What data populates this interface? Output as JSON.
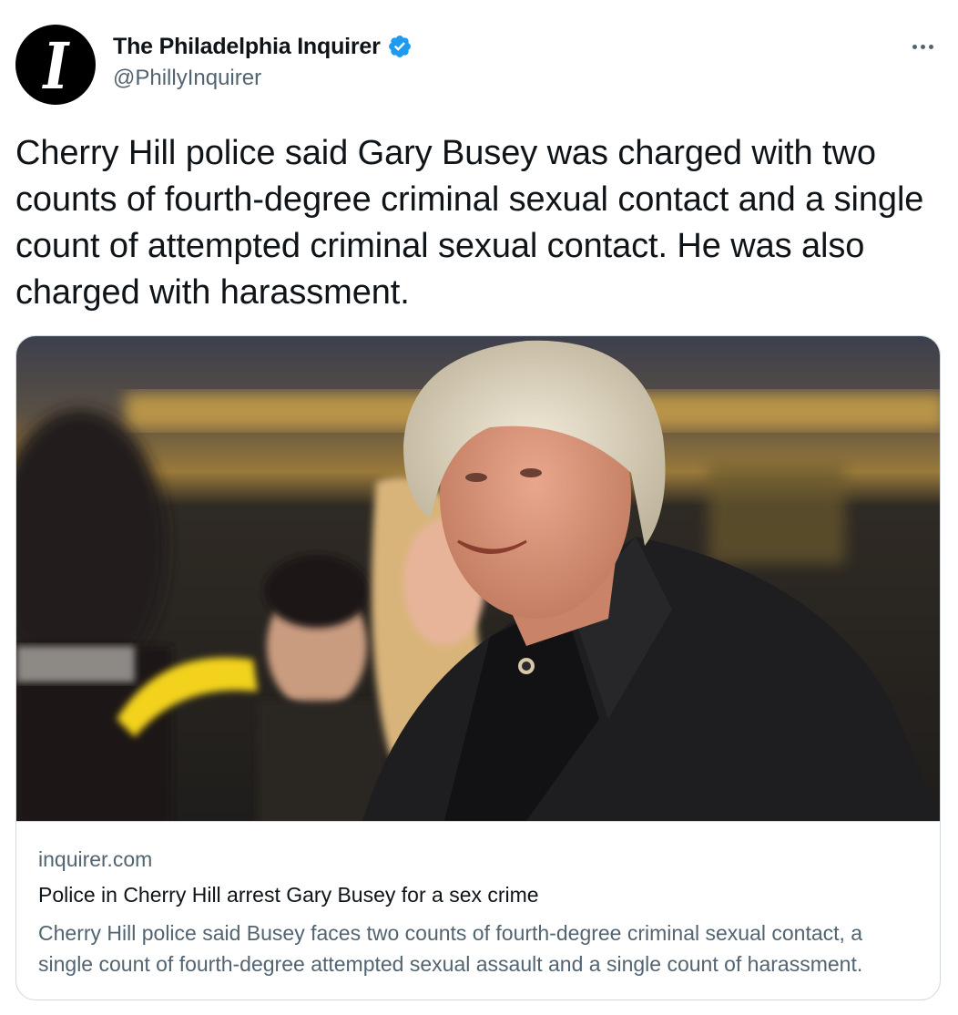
{
  "account": {
    "display_name": "The Philadelphia Inquirer",
    "handle": "@PhillyInquirer",
    "avatar_letter": "I",
    "verified": true,
    "verified_color": "#1d9bf0"
  },
  "tweet": {
    "text": "Cherry Hill police said Gary Busey was charged with two counts of fourth-degree criminal sexual contact and a single count of attempted criminal sexual contact. He was also charged with harassment."
  },
  "card": {
    "image_icon": "photo-of-gary-busey",
    "domain": "inquirer.com",
    "title": "Police in Cherry Hill arrest Gary Busey for a sex crime",
    "description": "Cherry Hill police said Busey faces two counts of fourth-degree criminal sexual contact, a single count of fourth-degree attempted sexual assault and a single count of harassment."
  },
  "icons": {
    "more": "more-horizontal-icon",
    "verified": "verified-badge-icon"
  },
  "colors": {
    "text_primary": "#0f1419",
    "text_secondary": "#536471",
    "border": "#cfd9de"
  }
}
